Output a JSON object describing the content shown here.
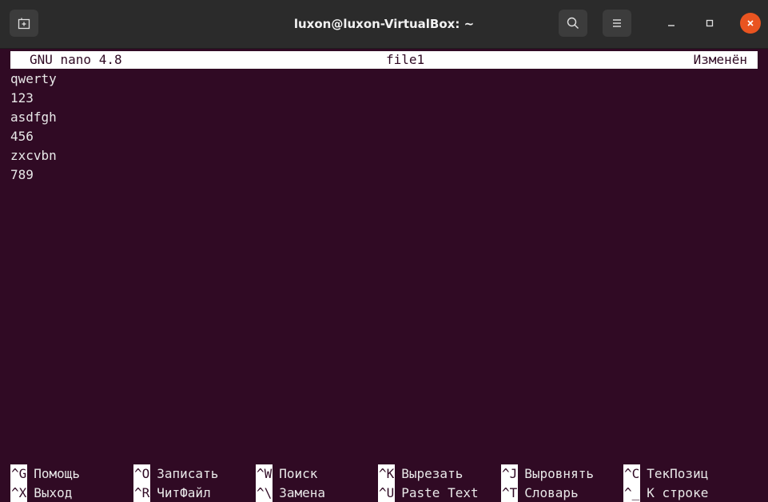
{
  "window": {
    "title": "luxon@luxon-VirtualBox: ~"
  },
  "icons": {
    "new_tab": "new-tab-icon",
    "search": "search-icon",
    "menu": "hamburger-menu-icon",
    "minimize": "minimize-icon",
    "maximize": "maximize-icon",
    "close": "close-icon"
  },
  "colors": {
    "terminal_bg": "#300a24",
    "titlebar_bg": "#2b2b2b",
    "close_button": "#e95420",
    "text": "#e8e8e8"
  },
  "nano": {
    "version": "GNU nano 4.8",
    "filename": "file1",
    "state": "Изменён",
    "lines": [
      "qwerty",
      "123",
      "asdfgh",
      "456",
      "zxcvbn",
      "789"
    ],
    "shortcuts_row1": [
      {
        "key": "^G",
        "label": "Помощь"
      },
      {
        "key": "^O",
        "label": "Записать"
      },
      {
        "key": "^W",
        "label": "Поиск"
      },
      {
        "key": "^K",
        "label": "Вырезать"
      },
      {
        "key": "^J",
        "label": "Выровнять"
      },
      {
        "key": "^C",
        "label": "ТекПозиц"
      }
    ],
    "shortcuts_row2": [
      {
        "key": "^X",
        "label": "Выход"
      },
      {
        "key": "^R",
        "label": "ЧитФайл"
      },
      {
        "key": "^\\",
        "label": "Замена"
      },
      {
        "key": "^U",
        "label": "Paste Text"
      },
      {
        "key": "^T",
        "label": "Словарь"
      },
      {
        "key": "^_",
        "label": "К строке"
      }
    ]
  }
}
